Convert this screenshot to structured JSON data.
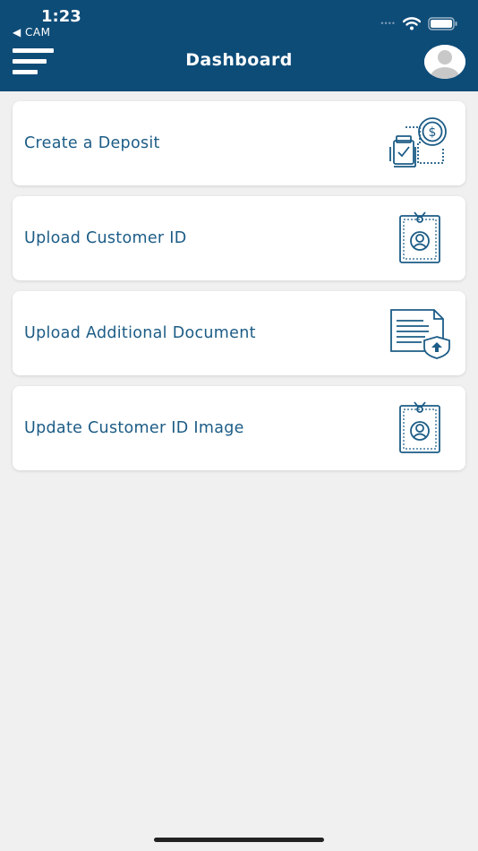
{
  "status_bar": {
    "time": "1:23",
    "back_app": "◀ CAM"
  },
  "header": {
    "title": "Dashboard",
    "background": "#0e4c78"
  },
  "icons": {
    "menu": "hamburger-menu-icon",
    "profile": "avatar-icon",
    "deposit": "deposit-money-icon",
    "customer_id": "id-badge-icon",
    "document": "document-upload-icon"
  },
  "items": [
    {
      "label": "Create a Deposit",
      "icon": "deposit-money-icon"
    },
    {
      "label": "Upload Customer ID",
      "icon": "id-badge-icon"
    },
    {
      "label": "Upload Additional Document",
      "icon": "document-upload-icon"
    },
    {
      "label": "Update Customer ID Image",
      "icon": "id-badge-icon"
    }
  ],
  "colors": {
    "brand": "#0e4c78",
    "label_text": "#1c5c86",
    "page_background": "#f0f0f0"
  }
}
